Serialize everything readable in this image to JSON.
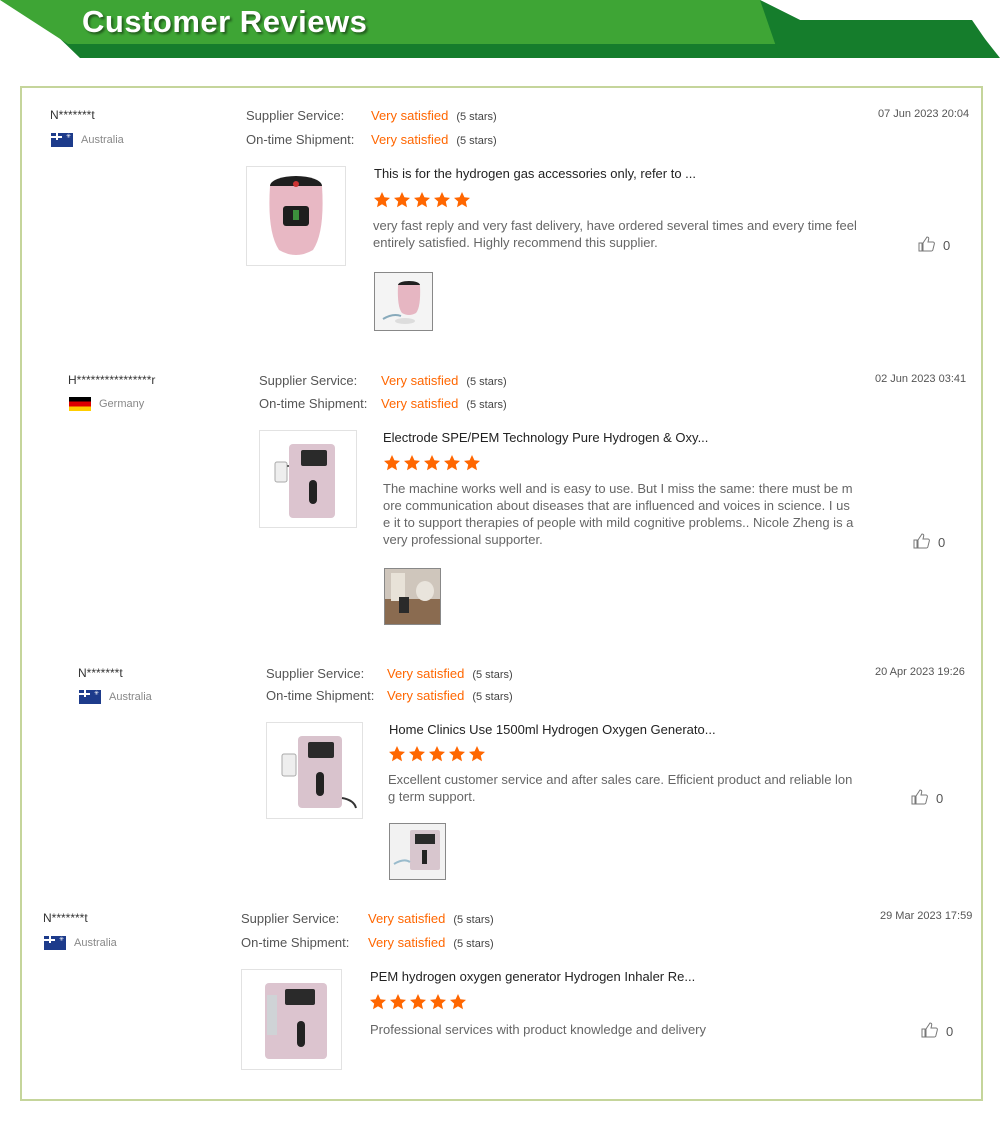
{
  "header": {
    "title": "Customer Reviews"
  },
  "colors": {
    "accent": "#ff6600",
    "banner_green": "#3ea535",
    "banner_dark": "#157d2c",
    "frame": "#c5d59b"
  },
  "labels": {
    "supplier_service": "Supplier Service:",
    "on_time_shipment": "On-time Shipment:"
  },
  "reviews": [
    {
      "user": "N*******t",
      "country": "Australia",
      "flag": "australia-flag",
      "supplier_rating": "Very satisfied",
      "supplier_stars": "(5 stars)",
      "shipment_rating": "Very satisfied",
      "shipment_stars": "(5 stars)",
      "date": "07 Jun 2023 20:04",
      "product_title": "This is for the hydrogen gas accessories only, refer to ...",
      "rating": 5,
      "text": "very fast reply and very fast delivery, have ordered several times and every time feel entirely satisfied. Highly recommend this supplier.",
      "likes": "0",
      "has_photo": true
    },
    {
      "user": "H****************r",
      "country": "Germany",
      "flag": "germany-flag",
      "supplier_rating": "Very satisfied",
      "supplier_stars": "(5 stars)",
      "shipment_rating": "Very satisfied",
      "shipment_stars": "(5 stars)",
      "date": "02 Jun 2023 03:41",
      "product_title": "Electrode SPE/PEM Technology Pure Hydrogen & Oxy...",
      "rating": 5,
      "text": "The machine works well and is easy to use. But I miss the same: there must be more communication about diseases that are influenced and voices in science. I use it to support therapies of people with mild cognitive problems.. Nicole Zheng is a very professional supporter.",
      "likes": "0",
      "has_photo": true
    },
    {
      "user": "N*******t",
      "country": "Australia",
      "flag": "australia-flag",
      "supplier_rating": "Very satisfied",
      "supplier_stars": "(5 stars)",
      "shipment_rating": "Very satisfied",
      "shipment_stars": "(5 stars)",
      "date": "20 Apr 2023 19:26",
      "product_title": "Home Clinics Use 1500ml Hydrogen Oxygen Generato...",
      "rating": 5,
      "text": "Excellent customer service and after sales care. Efficient product and reliable long term support.",
      "likes": "0",
      "has_photo": true
    },
    {
      "user": "N*******t",
      "country": "Australia",
      "flag": "australia-flag",
      "supplier_rating": "Very satisfied",
      "supplier_stars": "(5 stars)",
      "shipment_rating": "Very satisfied",
      "shipment_stars": "(5 stars)",
      "date": "29 Mar 2023 17:59",
      "product_title": "PEM hydrogen oxygen generator Hydrogen Inhaler Re...",
      "rating": 5,
      "text": "Professional services with product knowledge and delivery",
      "likes": "0",
      "has_photo": false
    }
  ]
}
